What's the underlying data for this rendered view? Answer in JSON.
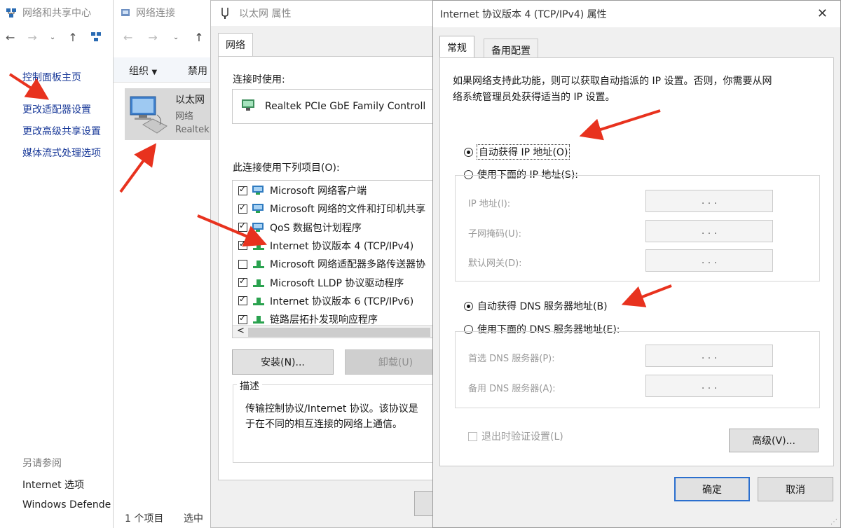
{
  "w1": {
    "title": "网络和共享中心",
    "links": [
      "控制面板主页",
      "更改适配器设置",
      "更改高级共享设置",
      "媒体流式处理选项"
    ],
    "see_also_heading": "另请参阅",
    "see_also_links": [
      "Internet 选项",
      "Windows Defende"
    ]
  },
  "w2": {
    "title": "网络连接",
    "toolbar": {
      "organize": "组织",
      "disable": "禁用"
    },
    "adapter": {
      "name": "以太网",
      "status": "网络",
      "device": "Realtek"
    },
    "status": {
      "count": "1 个项目",
      "selected": "选中"
    }
  },
  "w3": {
    "title": "以太网 属性",
    "tab": "网络",
    "connect_using_label": "连接时使用:",
    "adapter_name": "Realtek PCIe GbE Family Controll",
    "items_label": "此连接使用下列项目(O):",
    "items": [
      {
        "label": "Microsoft 网络客户端",
        "checked": true
      },
      {
        "label": "Microsoft 网络的文件和打印机共享",
        "checked": true
      },
      {
        "label": "QoS 数据包计划程序",
        "checked": true
      },
      {
        "label": "Internet 协议版本 4 (TCP/IPv4)",
        "checked": true
      },
      {
        "label": "Microsoft 网络适配器多路传送器协",
        "checked": false
      },
      {
        "label": "Microsoft LLDP 协议驱动程序",
        "checked": true
      },
      {
        "label": "Internet 协议版本 6 (TCP/IPv6)",
        "checked": true
      },
      {
        "label": "链路层拓扑发现响应程序",
        "checked": true
      }
    ],
    "scroll_left": "<",
    "install_button": "安装(N)...",
    "uninstall_button": "卸载(U)",
    "description_label": "描述",
    "description_text": "传输控制协议/Internet 协议。该协议是\n于在不同的相互连接的网络上通信。"
  },
  "w4": {
    "title": "Internet 协议版本 4 (TCP/IPv4) 属性",
    "close": "✕",
    "tabs": [
      "常规",
      "备用配置"
    ],
    "intro": "如果网络支持此功能，则可以获取自动指派的 IP 设置。否则，你需要从网\n络系统管理员处获得适当的 IP 设置。",
    "auto_ip": "自动获得 IP 地址(O)",
    "manual_ip": "使用下面的 IP 地址(S):",
    "ip_label": "IP 地址(I):",
    "mask_label": "子网掩码(U):",
    "gateway_label": "默认网关(D):",
    "auto_dns": "自动获得 DNS 服务器地址(B)",
    "manual_dns": "使用下面的 DNS 服务器地址(E):",
    "pref_dns_label": "首选 DNS 服务器(P):",
    "alt_dns_label": "备用 DNS 服务器(A):",
    "ip_dots": ".   .   .",
    "validate_label": "退出时验证设置(L)",
    "advanced_button": "高级(V)...",
    "ok_button": "确定",
    "cancel_button": "取消"
  },
  "colors": {
    "link": "#1a3a99",
    "arrow": "#e8321e",
    "focus": "#2b6fce"
  }
}
